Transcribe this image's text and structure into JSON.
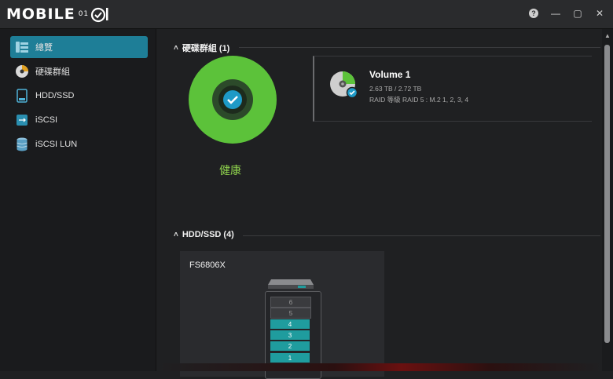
{
  "app": {
    "logo_text": "MOBILE",
    "logo_sub": "01"
  },
  "window_controls": {
    "help": "?",
    "minimize": "—",
    "maximize": "▢",
    "close": "✕"
  },
  "sidebar": {
    "items": [
      {
        "label": "總覽",
        "icon": "overview-icon",
        "active": true
      },
      {
        "label": "硬碟群組",
        "icon": "disk-group-icon",
        "active": false
      },
      {
        "label": "HDD/SSD",
        "icon": "hdd-ssd-icon",
        "active": false
      },
      {
        "label": "iSCSI",
        "icon": "iscsi-icon",
        "active": false
      },
      {
        "label": "iSCSI LUN",
        "icon": "iscsi-lun-icon",
        "active": false
      }
    ]
  },
  "disk_group": {
    "header": "硬碟群組 (1)",
    "health_label": "健康",
    "volume": {
      "name": "Volume 1",
      "capacity": "2.63 TB / 2.72 TB",
      "raid": "RAID 等級 RAID 5 : M.2 1, 2, 3, 4"
    }
  },
  "hdd_ssd": {
    "header": "HDD/SSD (4)",
    "device": {
      "name": "FS6806X",
      "bays": [
        {
          "label": "6",
          "state": "empty"
        },
        {
          "label": "5",
          "state": "empty"
        },
        {
          "label": "4",
          "state": "filled"
        },
        {
          "label": "3",
          "state": "filled"
        },
        {
          "label": "2",
          "state": "filled"
        },
        {
          "label": "1",
          "state": "filled"
        }
      ]
    }
  },
  "colors": {
    "accent": "#1e7e97",
    "health_green": "#5cc23a",
    "health_text": "#8fd24d",
    "bay_filled": "#1f9c9e"
  }
}
